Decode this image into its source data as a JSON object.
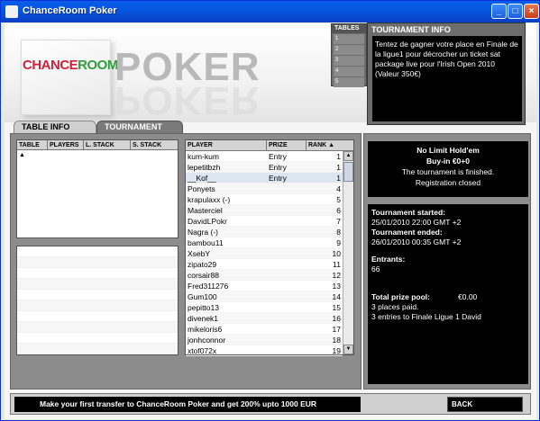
{
  "window": {
    "title": "ChanceRoom Poker"
  },
  "brand": {
    "chance": "CHANCE",
    "room": "ROOM",
    "poker": "POKER"
  },
  "mini_tables": {
    "header": "TABLES",
    "rows": [
      "1",
      "2",
      "3",
      "4",
      "5"
    ]
  },
  "tournament_info": {
    "header": "TOURNAMENT INFO",
    "text": "Tentez de gagner votre place en Finale de la ligue1 pour décrocher un ticket sat package live pour l'Irish Open 2010 (Valeur 350€)"
  },
  "tabs": {
    "table_info": "TABLE INFO",
    "tournament_info": "TOURNAMENT INFO"
  },
  "tables_table": {
    "columns": [
      "TABLE",
      "PLAYERS",
      "L. STACK",
      "S. STACK"
    ]
  },
  "players_table": {
    "columns": [
      "PLAYER",
      "PRIZE",
      "RANK"
    ],
    "rows": [
      {
        "player": "kum-kum",
        "prize": "Entry",
        "rank": "1"
      },
      {
        "player": "lepetitbzh",
        "prize": "Entry",
        "rank": "1"
      },
      {
        "player": "__Kof__",
        "prize": "Entry",
        "rank": "1"
      },
      {
        "player": "Ponyets",
        "prize": "",
        "rank": "4"
      },
      {
        "player": "krapulaxx (-)",
        "prize": "",
        "rank": "5"
      },
      {
        "player": "Masterciel",
        "prize": "",
        "rank": "6"
      },
      {
        "player": "DavidLPokr",
        "prize": "",
        "rank": "7"
      },
      {
        "player": "Nagra (-)",
        "prize": "",
        "rank": "8"
      },
      {
        "player": "bambou11",
        "prize": "",
        "rank": "9"
      },
      {
        "player": "XsebY",
        "prize": "",
        "rank": "10"
      },
      {
        "player": "zipato29",
        "prize": "",
        "rank": "11"
      },
      {
        "player": "corsair88",
        "prize": "",
        "rank": "12"
      },
      {
        "player": "Fred311276",
        "prize": "",
        "rank": "13"
      },
      {
        "player": "Gum100",
        "prize": "",
        "rank": "14"
      },
      {
        "player": "pepitto13",
        "prize": "",
        "rank": "15"
      },
      {
        "player": "divenek1",
        "prize": "",
        "rank": "16"
      },
      {
        "player": "mikeloris6",
        "prize": "",
        "rank": "17"
      },
      {
        "player": "jonhconnor",
        "prize": "",
        "rank": "18"
      },
      {
        "player": "xtof072x",
        "prize": "",
        "rank": "19"
      }
    ]
  },
  "game": {
    "name": "No Limit Hold'em",
    "buyin": "Buy-in €0+0",
    "status1": "The tournament is finished.",
    "status2": "Registration closed"
  },
  "details": {
    "started_label": "Tournament started:",
    "started_value": "25/01/2010 22:00 GMT +2",
    "ended_label": "Tournament ended:",
    "ended_value": "26/01/2010 00:35 GMT +2",
    "entrants_label": "Entrants:",
    "entrants_value": "66",
    "prize_label": "Total prize pool:",
    "prize_value": "€0.00",
    "places": "3 places paid.",
    "entries": "3 entries to Finale Ligue 1 David"
  },
  "footer": {
    "ticker": "Make your first transfer to ChanceRoom Poker and get 200% upto 1000 EUR",
    "back_label": "BACK"
  },
  "colors": {
    "titlebar": "#0a5ce6",
    "panel": "#8c8c8c",
    "black_box": "#000000"
  }
}
